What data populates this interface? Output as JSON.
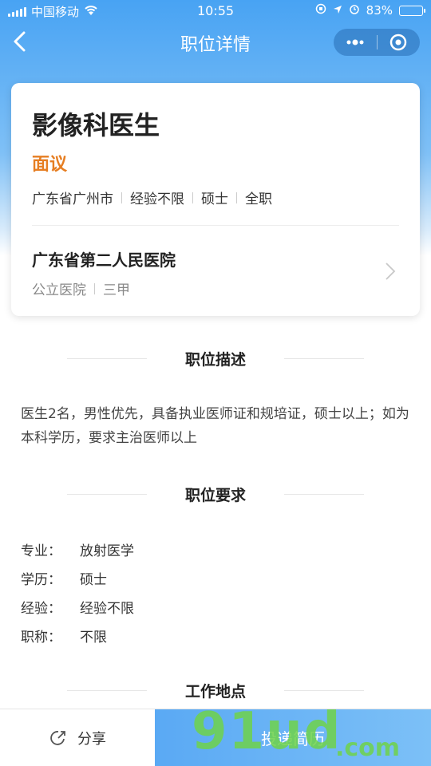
{
  "status_bar": {
    "carrier": "中国移动",
    "time": "10:55",
    "battery": "83%",
    "battery_level": 0.83
  },
  "nav": {
    "title": "职位详情"
  },
  "job": {
    "title": "影像科医生",
    "salary": "面议",
    "tags": [
      "广东省广州市",
      "经验不限",
      "硕士",
      "全职"
    ],
    "hospital": "广东省第二人民医院",
    "hospital_tags": [
      "公立医院",
      "三甲"
    ]
  },
  "sections": {
    "description_title": "职位描述",
    "description": "医生2名，男性优先，具备执业医师证和规培证，硕士以上；如为本科学历，要求主治医师以上",
    "requirements_title": "职位要求",
    "requirements": [
      {
        "key": "专业：",
        "value": "放射医学"
      },
      {
        "key": "学历：",
        "value": "硕士"
      },
      {
        "key": "经验：",
        "value": "经验不限"
      },
      {
        "key": "职称：",
        "value": "不限"
      }
    ],
    "location_title": "工作地点"
  },
  "bottom_bar": {
    "share_label": "分享",
    "apply_label": "投递简历"
  },
  "watermark": {
    "main": "91ud",
    "sub": ".com"
  },
  "colors": {
    "primary": "#4aa3f3",
    "salary": "#e67e22"
  }
}
